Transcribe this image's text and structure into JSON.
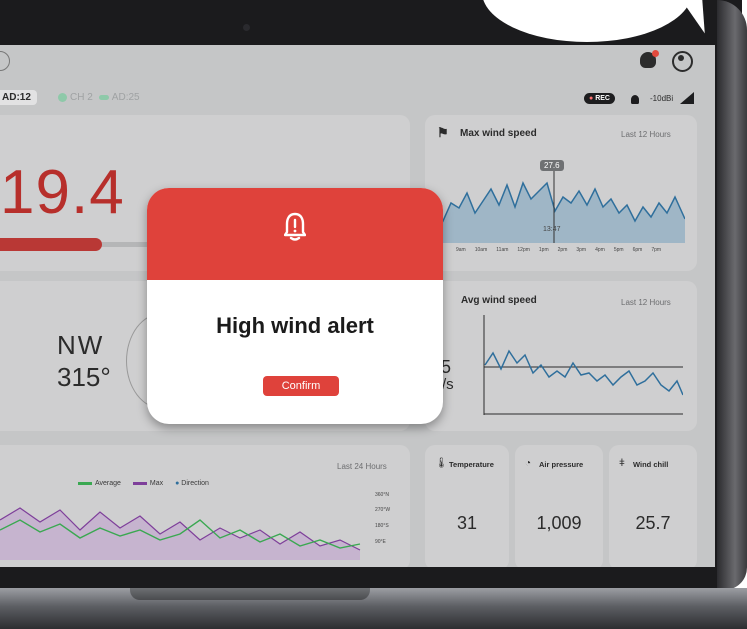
{
  "topbar": {
    "channel1": "AD:12",
    "channel2": "CH 2",
    "channel2_extra": "AD:25",
    "rec": "REC",
    "signal_text": "-10dBi"
  },
  "big_card": {
    "value": "19.4"
  },
  "max_wind": {
    "title": "Max wind speed",
    "range": "Last 12 Hours",
    "tooltip": "27.6",
    "cursor_time": "13:47",
    "x_ticks": [
      "9am",
      "10am",
      "11am",
      "12pm",
      "1pm",
      "2pm",
      "3pm",
      "4pm",
      "5pm",
      "6pm",
      "7pm"
    ]
  },
  "avg_wind": {
    "title": "Avg wind speed",
    "range": "Last 12 Hours",
    "value_fragment": ".5",
    "unit_fragment": "/s"
  },
  "direction": {
    "label": "NW",
    "degrees": "315°"
  },
  "trend": {
    "range": "Last 24 Hours",
    "legend": [
      "Average",
      "Max",
      "Direction"
    ],
    "y_ticks": [
      "360°N",
      "270°W",
      "180°S",
      "90°E"
    ]
  },
  "stats": {
    "temperature": {
      "label": "Temperature",
      "value": "31"
    },
    "air_pressure": {
      "label": "Air pressure",
      "value": "1,009"
    },
    "wind_chill": {
      "label": "Wind chill",
      "value": "25.7"
    }
  },
  "modal": {
    "title": "High wind alert",
    "confirm_label": "Confirm"
  },
  "colors": {
    "alert_red": "#df423b",
    "chart_blue": "#2f6f9c",
    "green": "#3aa851",
    "purple": "#7e3f9a"
  }
}
